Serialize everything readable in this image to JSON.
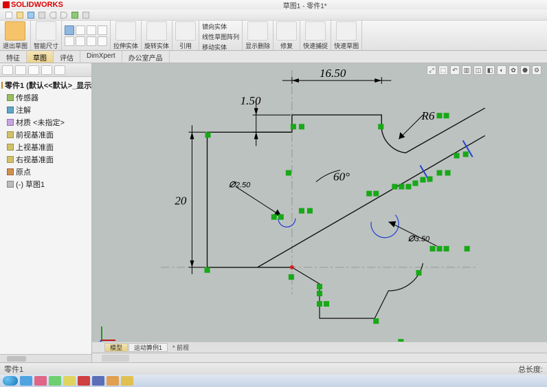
{
  "app": {
    "name": "SOLIDWORKS",
    "doc_title_center": "草图1 - 零件1*"
  },
  "ribbon": {
    "b0": "退出草图",
    "b1": "智能尺寸",
    "b2": "拉伸实体",
    "b3": "旋转实体",
    "b4": "引用",
    "b5": "镜向实体",
    "b6": "线性草图阵列",
    "b7": "移动实体",
    "b8": "显示删除",
    "b9": "修复",
    "b10": "快速捕捉",
    "b11": "快速草图"
  },
  "feature_tabs": {
    "t0": "特征",
    "t1": "草图",
    "t2": "评估",
    "t3": "DimXpert",
    "t4": "办公室产品"
  },
  "tree": {
    "root": "零件1 (默认<<默认>_显示状态",
    "n0": "传感器",
    "n1": "注解",
    "n2": "材质 <未指定>",
    "n3": "前视基准面",
    "n4": "上视基准面",
    "n5": "右视基准面",
    "n6": "原点",
    "n7": "(-) 草图1"
  },
  "sheet_tabs": {
    "s0": "模型",
    "s1": "运动算例1"
  },
  "canvas_label": "* 前视",
  "status": {
    "left": "零件1",
    "right": "总长度:"
  },
  "dimensions": {
    "d_16_50": "16.50",
    "d_1_50": "1.50",
    "d_20": "20",
    "r6": "R6",
    "dia_2_50": "2.50",
    "dia_3_50": "3.50",
    "ang_60": "60°"
  },
  "chart_data": {
    "type": "sketch",
    "units": "mm",
    "dims": [
      {
        "name": "horizontal",
        "value": 16.5
      },
      {
        "name": "vertical_small",
        "value": 1.5
      },
      {
        "name": "vertical_large",
        "value": 20
      },
      {
        "name": "fillet_radius",
        "value": 6
      },
      {
        "name": "diameter_small",
        "value": 2.5
      },
      {
        "name": "diameter_large",
        "value": 3.5
      },
      {
        "name": "angle_deg",
        "value": 60
      }
    ]
  }
}
